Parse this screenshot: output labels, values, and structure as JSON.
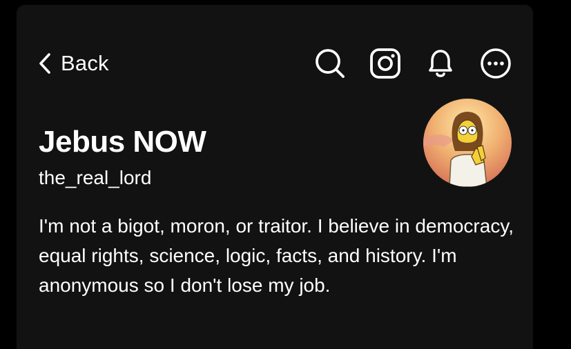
{
  "header": {
    "back_label": "Back",
    "icons": [
      "search-icon",
      "instagram-icon",
      "bell-icon",
      "more-options-icon"
    ]
  },
  "profile": {
    "display_name": "Jebus NOW",
    "username": "the_real_lord",
    "bio": "I'm not a bigot, moron, or traitor. I believe in democracy, equal rights, science, logic, facts, and history. I'm anonymous so I don't lose my job."
  },
  "colors": {
    "background": "#000000",
    "panel": "#121212",
    "text": "#ffffff"
  }
}
